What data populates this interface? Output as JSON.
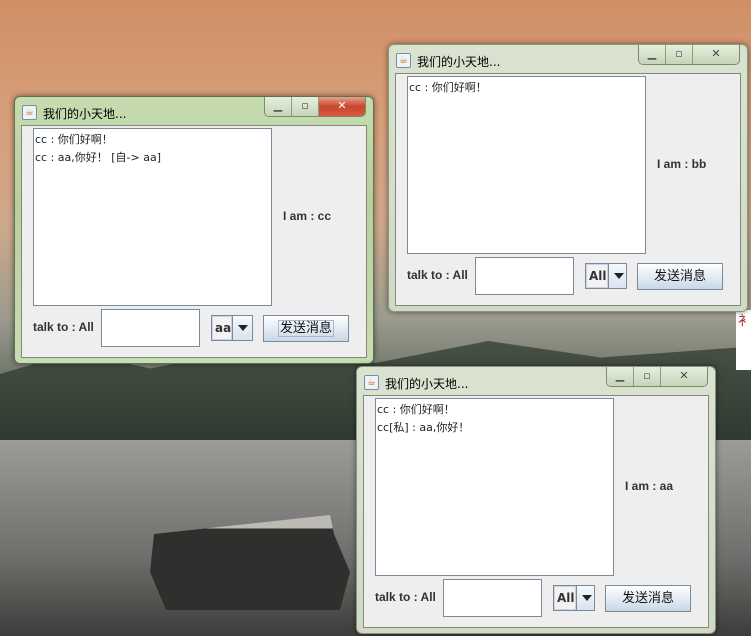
{
  "windows": [
    {
      "title": "我们的小天地...",
      "iam": "I am : cc",
      "talk": "talk to : All",
      "combo": "aa",
      "send": "发送消息",
      "messages": [
        "cc : 你们好啊！",
        "cc : aa,你好！ [自-> aa]"
      ]
    },
    {
      "title": "我们的小天地...",
      "iam": "I am : bb",
      "talk": "talk to : All",
      "combo": "All",
      "send": "发送消息",
      "messages": [
        "cc : 你们好啊！"
      ]
    },
    {
      "title": "我们的小天地...",
      "iam": "I am : aa",
      "talk": "talk to : All",
      "combo": "All",
      "send": "发送消息",
      "messages": [
        "cc : 你们好啊！",
        "cc[私] : aa,你好！"
      ]
    }
  ],
  "background_text": "衤"
}
